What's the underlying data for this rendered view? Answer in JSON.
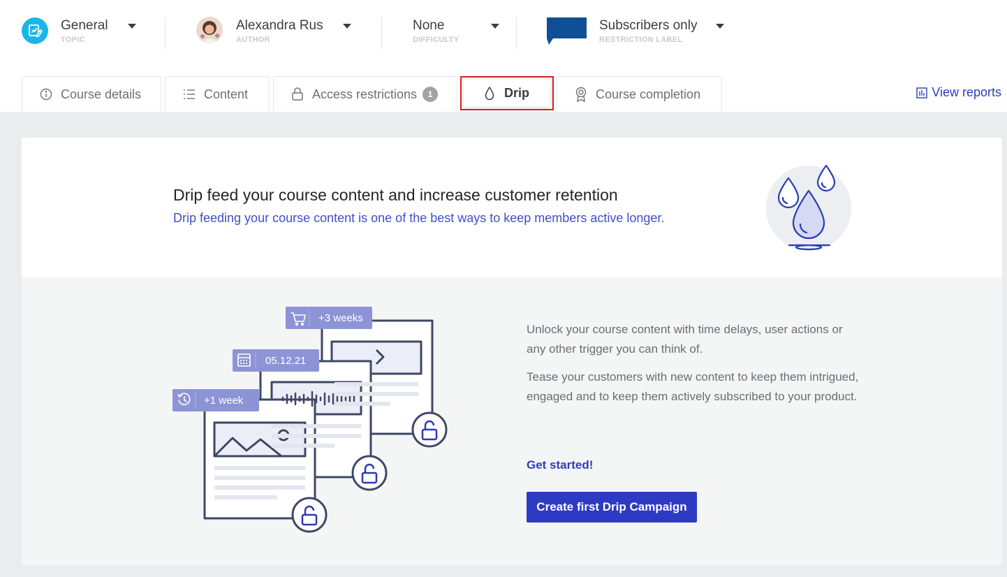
{
  "meta": {
    "topic": {
      "value": "General",
      "label": "TOPIC"
    },
    "author": {
      "value": "Alexandra Rus",
      "label": "AUTHOR"
    },
    "difficulty": {
      "value": "None",
      "label": "DIFFICULTY"
    },
    "restriction": {
      "value": "Subscribers only",
      "label": "RESTRICTION LABEL"
    }
  },
  "tabs": [
    {
      "label": "Course details",
      "icon": "info-icon"
    },
    {
      "label": "Content",
      "icon": "list-icon"
    },
    {
      "label": "Access restrictions",
      "icon": "lock-icon",
      "badge": "1"
    },
    {
      "label": "Drip",
      "icon": "drop-icon",
      "active": true
    },
    {
      "label": "Course completion",
      "icon": "award-icon"
    }
  ],
  "view_reports": "View reports",
  "hero": {
    "title": "Drip feed your course content and increase customer retention",
    "subtitle": "Drip feeding your course content is one of the best ways to keep members active longer."
  },
  "illustration": {
    "tag_1": "+3 weeks",
    "tag_2": "05.12.21",
    "tag_3": "+1 week"
  },
  "body": {
    "para_1": "Unlock your course content with time delays, user actions or any other trigger you can think of.",
    "para_2": "Tease your customers with new content to keep them intrigued, engaged and to keep them actively subscribed to your product.",
    "get_started": "Get started!",
    "cta": "Create first Drip Campaign"
  },
  "colors": {
    "accent": "#2d3ac3",
    "topic_icon_bg": "#19b6e8",
    "flag": "#0e4f96",
    "highlight_border": "#d8201f"
  }
}
